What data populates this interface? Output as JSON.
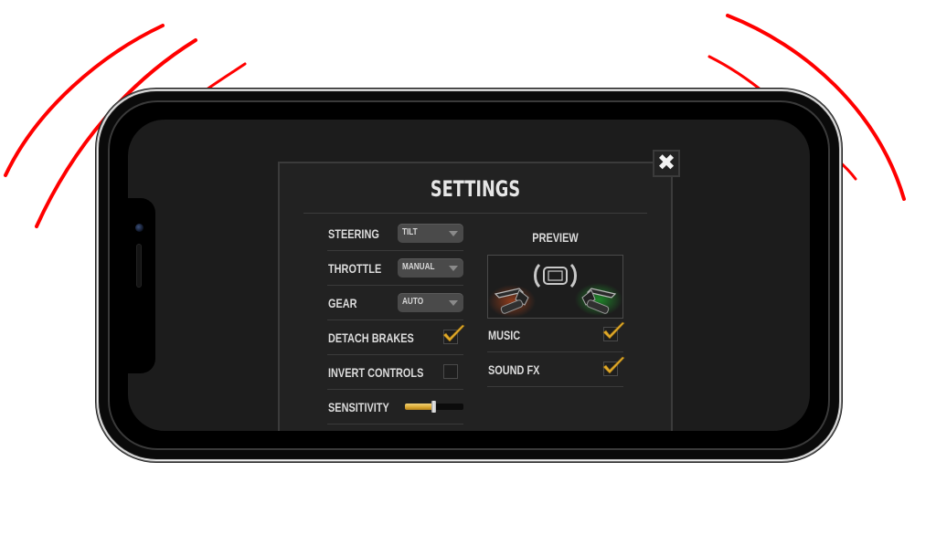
{
  "settings": {
    "title": "SETTINGS",
    "close_icon": "close-x-icon",
    "left_column": {
      "steering": {
        "label": "STEERING",
        "value": "TILT"
      },
      "throttle": {
        "label": "THROTTLE",
        "value": "MANUAL"
      },
      "gear": {
        "label": "GEAR",
        "value": "AUTO"
      },
      "detach_brakes": {
        "label": "DETACH BRAKES",
        "checked": true
      },
      "invert_controls": {
        "label": "INVERT CONTROLS",
        "checked": false
      },
      "sensitivity": {
        "label": "SENSITIVITY",
        "value_fraction": 0.48
      }
    },
    "right_column": {
      "preview_label": "PREVIEW",
      "preview_icons": [
        "tilt-phone-icon",
        "left-brake-lever-icon",
        "right-throttle-lever-icon"
      ],
      "music": {
        "label": "MUSIC",
        "checked": true
      },
      "sound_fx": {
        "label": "SOUND FX",
        "checked": true
      }
    }
  },
  "colors": {
    "accent_check": "#e0a92a",
    "slider_fill": "#d8a52e",
    "left_lever_glow": "#b5451b",
    "right_lever_glow": "#1f9a2c",
    "vibration_arcs": "#ff0000"
  }
}
